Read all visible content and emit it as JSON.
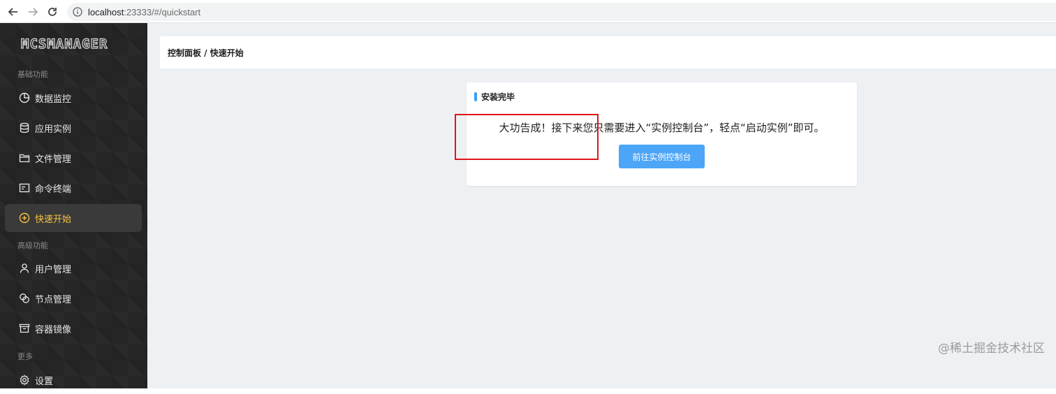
{
  "browser": {
    "url_host": "localhost",
    "url_rest": ":23333/#/quickstart"
  },
  "sidebar": {
    "logo": "MCSMANAGER",
    "sections": [
      {
        "title": "基础功能"
      },
      {
        "title": "高级功能"
      },
      {
        "title": "更多"
      }
    ],
    "items": [
      {
        "label": "数据监控",
        "icon": "pie-chart-icon"
      },
      {
        "label": "应用实例",
        "icon": "database-icon"
      },
      {
        "label": "文件管理",
        "icon": "folder-icon"
      },
      {
        "label": "命令终端",
        "icon": "terminal-icon"
      },
      {
        "label": "快速开始",
        "icon": "plus-circle-icon",
        "active": true
      },
      {
        "label": "用户管理",
        "icon": "user-icon"
      },
      {
        "label": "节点管理",
        "icon": "nodes-icon"
      },
      {
        "label": "容器镜像",
        "icon": "container-icon"
      },
      {
        "label": "设置",
        "icon": "gear-icon"
      }
    ]
  },
  "main": {
    "breadcrumb": "控制面板 / 快速开始",
    "card": {
      "title": "安装完毕",
      "message": "大功告成！接下来您只需要进入“实例控制台”，轻点“启动实例”即可。",
      "button_label": "前往实例控制台"
    }
  },
  "watermark": "@稀土掘金技术社区",
  "colors": {
    "sidebar_bg": "#262626",
    "active_text": "#f5c242",
    "button_bg": "#4ca5f7",
    "highlight_border": "#e0141b",
    "title_bar": "#3b9ef5"
  }
}
